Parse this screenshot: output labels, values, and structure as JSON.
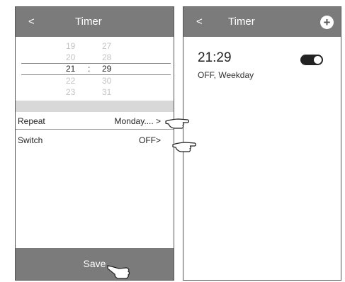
{
  "left_screen": {
    "back": "<",
    "title": "Timer",
    "picker": {
      "rows": [
        {
          "hour": "19",
          "minute": "27"
        },
        {
          "hour": "20",
          "minute": "28"
        },
        {
          "hour": "21",
          "minute": "29"
        },
        {
          "hour": "22",
          "minute": "30"
        },
        {
          "hour": "23",
          "minute": "31"
        }
      ],
      "colon": ":"
    },
    "repeat": {
      "label": "Repeat",
      "value": "Monday.... >"
    },
    "switch": {
      "label": "Switch",
      "value": "OFF>"
    },
    "save": "Save"
  },
  "right_screen": {
    "back": "<",
    "title": "Timer",
    "add": "+",
    "timer": {
      "time": "21:29",
      "detail": "OFF, Weekday",
      "enabled": true
    }
  }
}
